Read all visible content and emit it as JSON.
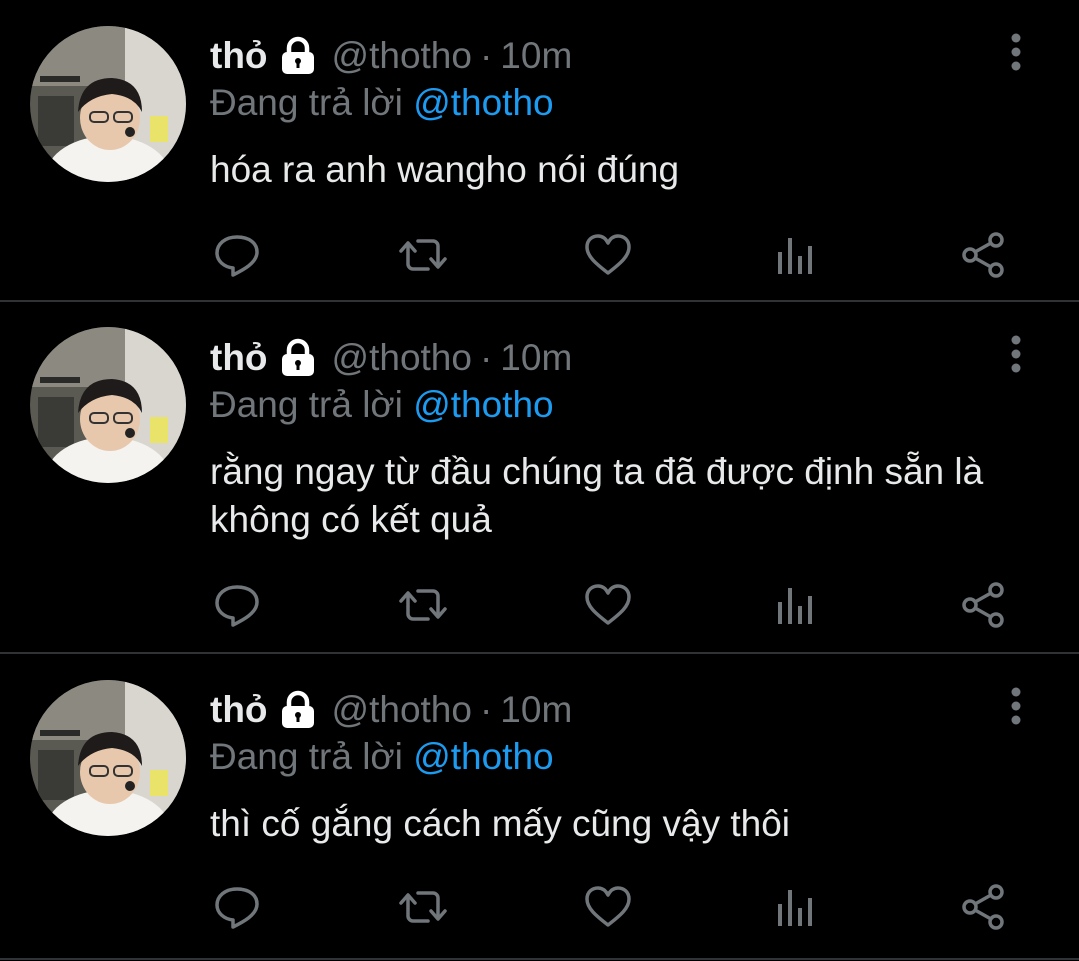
{
  "colors": {
    "background": "#000000",
    "primary_text": "#e7e9ea",
    "secondary_text": "#71767b",
    "accent": "#1d9bf0",
    "divider": "#2f3336"
  },
  "tweets": [
    {
      "display_name": "thỏ",
      "handle": "@thotho",
      "dot": "·",
      "time": "10m",
      "reply_prefix": "Đang trả lời",
      "reply_to": "@thotho",
      "text": "hóa ra anh wangho nói đúng",
      "icons": {
        "lock": "lock-icon",
        "more": "more-vertical-icon",
        "reply": "reply-icon",
        "retweet": "retweet-icon",
        "like": "heart-icon",
        "views": "analytics-icon",
        "share": "share-icon"
      }
    },
    {
      "display_name": "thỏ",
      "handle": "@thotho",
      "dot": "·",
      "time": "10m",
      "reply_prefix": "Đang trả lời",
      "reply_to": "@thotho",
      "text": "rằng ngay từ đầu chúng ta đã được định sẵn là không có kết quả",
      "icons": {
        "lock": "lock-icon",
        "more": "more-vertical-icon",
        "reply": "reply-icon",
        "retweet": "retweet-icon",
        "like": "heart-icon",
        "views": "analytics-icon",
        "share": "share-icon"
      }
    },
    {
      "display_name": "thỏ",
      "handle": "@thotho",
      "dot": "·",
      "time": "10m",
      "reply_prefix": "Đang trả lời",
      "reply_to": "@thotho",
      "text": "thì cố gắng cách mấy cũng vậy thôi",
      "icons": {
        "lock": "lock-icon",
        "more": "more-vertical-icon",
        "reply": "reply-icon",
        "retweet": "retweet-icon",
        "like": "heart-icon",
        "views": "analytics-icon",
        "share": "share-icon"
      }
    }
  ]
}
